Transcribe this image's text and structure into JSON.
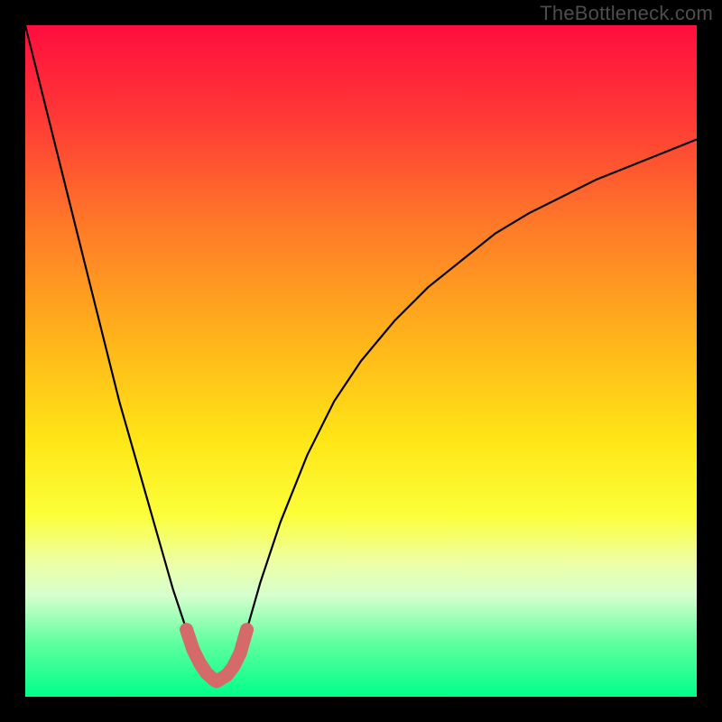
{
  "watermark": {
    "text": "TheBottleneck.com"
  },
  "colors": {
    "frame_bg": "#000000",
    "gradient_stops": [
      {
        "pct": 0,
        "color": "#ff0d3e"
      },
      {
        "pct": 14,
        "color": "#ff3a36"
      },
      {
        "pct": 30,
        "color": "#ff7a28"
      },
      {
        "pct": 48,
        "color": "#ffb81a"
      },
      {
        "pct": 62,
        "color": "#ffe617"
      },
      {
        "pct": 73,
        "color": "#fbff3a"
      },
      {
        "pct": 80,
        "color": "#eeffa6"
      },
      {
        "pct": 85,
        "color": "#d5ffcd"
      },
      {
        "pct": 92,
        "color": "#5eff9e"
      },
      {
        "pct": 100,
        "color": "#00ff8a"
      }
    ],
    "curve_stroke": "#000000",
    "notch_stroke": "#d46a6a"
  },
  "chart_data": {
    "type": "line",
    "title": "",
    "xlabel": "",
    "ylabel": "",
    "x_range": [
      0,
      100
    ],
    "y_range": [
      0,
      100
    ],
    "notch_x_range": [
      24,
      33
    ],
    "notch_depth_pct": 98,
    "series": [
      {
        "name": "bottleneck-curve",
        "x": [
          0,
          2,
          4,
          6,
          8,
          10,
          12,
          14,
          16,
          18,
          20,
          22,
          24,
          25,
          26,
          27,
          28,
          29,
          30,
          31,
          32,
          33,
          35,
          38,
          42,
          46,
          50,
          55,
          60,
          65,
          70,
          75,
          80,
          85,
          90,
          95,
          100
        ],
        "y": [
          100,
          92,
          84,
          76,
          68,
          60,
          52,
          44,
          37,
          30,
          23,
          16,
          10,
          7,
          5,
          3.5,
          2.6,
          2.3,
          2.6,
          3.5,
          6,
          10,
          17,
          26,
          36,
          44,
          50,
          56,
          61,
          65,
          69,
          72,
          74.5,
          77,
          79,
          81,
          83
        ]
      }
    ],
    "notch": {
      "name": "optimal-notch",
      "x": [
        24,
        25,
        26,
        27,
        28,
        28.5,
        29,
        30,
        31,
        32,
        33
      ],
      "y": [
        10,
        7,
        5,
        3.5,
        2.6,
        2.3,
        2.6,
        3.2,
        4.5,
        6.5,
        10
      ]
    }
  }
}
